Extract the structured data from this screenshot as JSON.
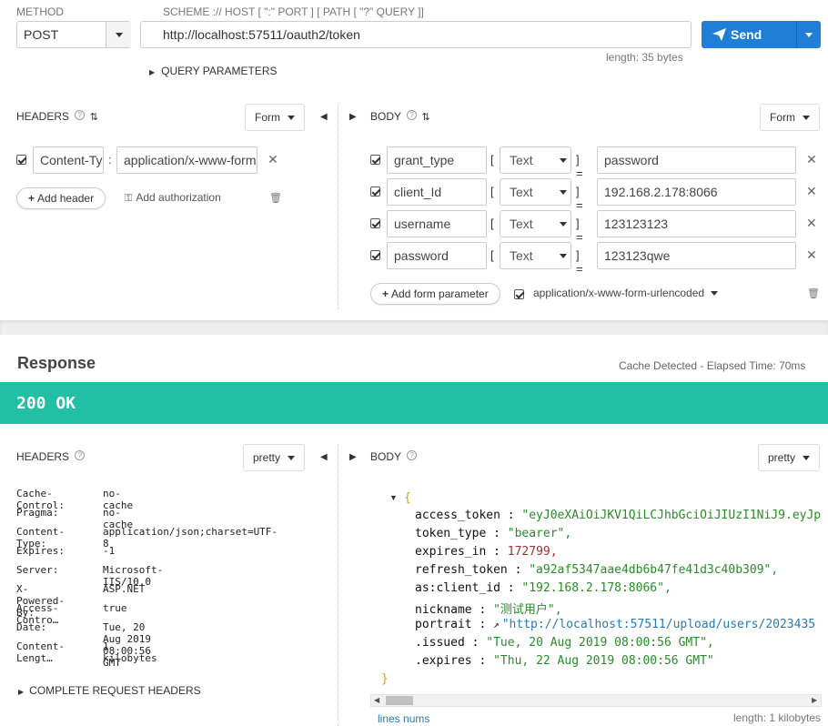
{
  "request": {
    "method_label": "METHOD",
    "method_value": "POST",
    "url_label": "SCHEME :// HOST [ \":\" PORT ] [ PATH [ \"?\" QUERY ]]",
    "url_value": "http://localhost:57511/oauth2/token",
    "length": "length: 35 bytes",
    "send_label": "Send",
    "query_params": "QUERY PARAMETERS"
  },
  "req_headers": {
    "title": "HEADERS",
    "mode": "Form",
    "rows": [
      {
        "name": "Content-Ty",
        "sep": ":",
        "value": "application/x-www-form"
      }
    ],
    "add_header": "Add header",
    "add_auth": "Add authorization"
  },
  "req_body": {
    "title": "BODY",
    "mode": "Form",
    "rows": [
      {
        "key": "grant_type",
        "type": "Text",
        "value": "password"
      },
      {
        "key": "client_Id",
        "type": "Text",
        "value": "192.168.2.178:8066"
      },
      {
        "key": "username",
        "type": "Text",
        "value": "123123123"
      },
      {
        "key": "password",
        "type": "Text",
        "value": "123123qwe"
      }
    ],
    "bracket_open": "[",
    "bracket_close": "] =",
    "add_param": "Add form parameter",
    "encoding": "application/x-www-form-urlencoded"
  },
  "response": {
    "title": "Response",
    "cache": "Cache Detected - Elapsed Time: 70ms",
    "status": "200 OK",
    "status_color": "#21c0a5",
    "headers_title": "HEADERS",
    "headers_mode": "pretty",
    "headers": [
      {
        "k": "Cache-Control:",
        "v": "no-cache"
      },
      {
        "k": "Pragma:",
        "v": "no-cache"
      },
      {
        "k": "Content-Type:",
        "v": "application/json;charset=UTF-8"
      },
      {
        "k": "Expires:",
        "v": "-1"
      },
      {
        "k": "Server:",
        "v": "Microsoft-IIS/10.0"
      },
      {
        "k": "X-Powered-By:",
        "v": "ASP.NET"
      },
      {
        "k": "Access-Contro…",
        "v": "true"
      },
      {
        "k": "Date:",
        "v": "Tue, 20 Aug 2019 08:00:56 GMT"
      },
      {
        "k": "Content-Lengt…",
        "v": "1 kilobytes"
      }
    ],
    "complete_headers": "COMPLETE REQUEST HEADERS",
    "body_title": "BODY",
    "body_mode": "pretty",
    "json_open": "{",
    "json_close": "}",
    "json": [
      {
        "k": "access_token",
        "v": "\"eyJ0eXAiOiJKV1QiLCJhbGciOiJIUzI1NiJ9.eyJpc",
        "t": "str"
      },
      {
        "k": "token_type",
        "v": "\"bearer\",",
        "t": "str"
      },
      {
        "k": "expires_in",
        "v": "172799,",
        "t": "num"
      },
      {
        "k": "refresh_token",
        "v": "\"a92af5347aae4db6b47fe41d3c40b309\",",
        "t": "str"
      },
      {
        "k": "as:client_id",
        "v": "\"192.168.2.178:8066\",",
        "t": "str"
      },
      {
        "k": "nickname",
        "v": "\"测试用户\",",
        "t": "str"
      },
      {
        "k": "portrait",
        "v": "\"http://localhost:57511/upload/users/2023435",
        "t": "link"
      },
      {
        "k": ".issued",
        "v": "\"Tue, 20 Aug 2019 08:00:56 GMT\",",
        "t": "str"
      },
      {
        "k": ".expires",
        "v": "\"Thu, 22 Aug 2019 08:00:56 GMT\"",
        "t": "str"
      }
    ],
    "colon": ":",
    "lines_nums": "lines nums",
    "length": "length: 1 kilobytes"
  }
}
